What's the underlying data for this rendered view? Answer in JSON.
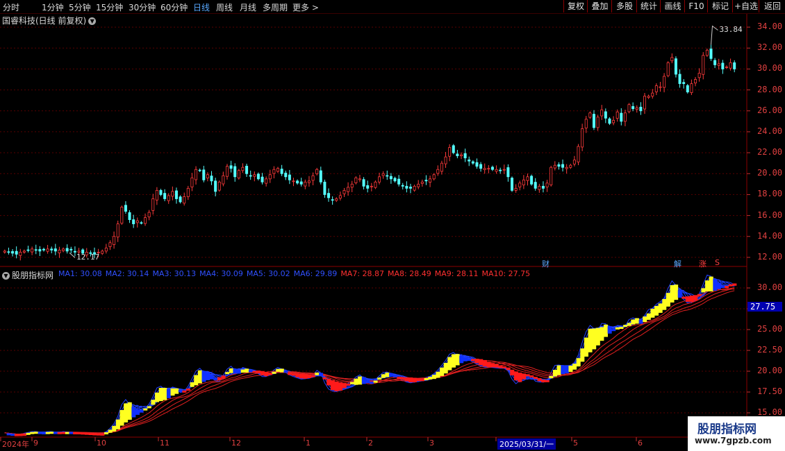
{
  "periods": [
    {
      "label": "分时",
      "active": false
    },
    {
      "label": "1分钟",
      "active": false
    },
    {
      "label": "5分钟",
      "active": false
    },
    {
      "label": "15分钟",
      "active": false
    },
    {
      "label": "30分钟",
      "active": false
    },
    {
      "label": "60分钟",
      "active": false
    },
    {
      "label": "日线",
      "active": true
    },
    {
      "label": "周线",
      "active": false
    },
    {
      "label": "月线",
      "active": false
    },
    {
      "label": "多周期",
      "active": false
    },
    {
      "label": "更多 >",
      "active": false
    }
  ],
  "toolbar": [
    "复权",
    "叠加",
    "多股",
    "统计",
    "画线",
    "F10",
    "标记",
    "+自选",
    "返回"
  ],
  "stock_title": "国睿科技(日线 前复权)",
  "price_axis": [
    "34.00",
    "32.00",
    "30.00",
    "28.00",
    "26.00",
    "24.00",
    "22.00",
    "20.00",
    "18.00",
    "16.00",
    "14.00",
    "12.00"
  ],
  "price_high_label": "33.84",
  "price_low_label": "12.17",
  "markers": {
    "cai": "财",
    "jie": "解",
    "zhang": "涨",
    "s": "S"
  },
  "indicator": {
    "name": "股朋指标网",
    "ma": [
      {
        "text": "MA1: 30.08",
        "color": "#3050ff"
      },
      {
        "text": "MA2: 30.14",
        "color": "#3050ff"
      },
      {
        "text": "MA3: 30.13",
        "color": "#3050ff"
      },
      {
        "text": "MA4: 30.09",
        "color": "#3050ff"
      },
      {
        "text": "MA5: 30.02",
        "color": "#3050ff"
      },
      {
        "text": "MA6: 29.89",
        "color": "#3050ff"
      },
      {
        "text": "MA7: 28.87",
        "color": "#ff3030"
      },
      {
        "text": "MA8: 28.49",
        "color": "#ff3030"
      },
      {
        "text": "MA9: 28.11",
        "color": "#ff3030"
      },
      {
        "text": "MA10: 27.75",
        "color": "#ff3030"
      }
    ],
    "axis": [
      "30.00",
      "27.50",
      "25.00",
      "22.50",
      "20.00",
      "17.50",
      "15.00"
    ],
    "current": "27.75"
  },
  "dates": [
    {
      "label": "2024年",
      "highlight": false
    },
    {
      "label": "9",
      "highlight": false
    },
    {
      "label": "10",
      "highlight": false
    },
    {
      "label": "11",
      "highlight": false
    },
    {
      "label": "12",
      "highlight": false
    },
    {
      "label": "1",
      "highlight": false
    },
    {
      "label": "2",
      "highlight": false
    },
    {
      "label": "3",
      "highlight": false
    },
    {
      "label": "2025/03/31/一",
      "highlight": true
    },
    {
      "label": "5",
      "highlight": false
    },
    {
      "label": "6",
      "highlight": false
    }
  ],
  "watermark": {
    "line1": "股朋指标网",
    "line2": "www.7gpzb.com"
  },
  "chart_data": {
    "type": "candlestick",
    "price_range": [
      11.2,
      35.2
    ],
    "indicator_range": [
      15,
      31.5
    ],
    "closes": [
      12.6,
      12.5,
      12.4,
      12.3,
      12.5,
      12.6,
      12.7,
      12.8,
      12.7,
      12.6,
      12.7,
      12.8,
      12.7,
      12.6,
      12.7,
      12.8,
      12.6,
      12.7,
      12.5,
      12.6,
      12.4,
      12.5,
      12.4,
      12.3,
      12.5,
      12.6,
      12.9,
      13.4,
      14.0,
      15.2,
      16.8,
      16.4,
      15.6,
      15.2,
      15.5,
      15.3,
      15.8,
      16.3,
      17.6,
      18.4,
      18.0,
      17.6,
      17.9,
      18.3,
      17.6,
      17.3,
      17.8,
      18.6,
      19.6,
      20.4,
      20.3,
      19.4,
      19.9,
      19.3,
      18.3,
      19.2,
      19.8,
      20.7,
      20.5,
      19.7,
      20.3,
      20.6,
      20.0,
      19.8,
      19.9,
      19.5,
      19.2,
      19.5,
      19.9,
      20.4,
      20.5,
      20.0,
      19.7,
      19.4,
      19.3,
      19.1,
      19.0,
      19.2,
      19.3,
      19.8,
      20.4,
      19.2,
      18.0,
      17.7,
      17.5,
      17.6,
      17.9,
      18.4,
      18.7,
      19.0,
      19.6,
      19.5,
      18.8,
      18.6,
      18.8,
      19.2,
      19.7,
      20.0,
      19.8,
      19.5,
      19.3,
      19.0,
      18.8,
      18.6,
      18.6,
      18.8,
      19.0,
      19.2,
      19.3,
      19.5,
      19.9,
      20.4,
      21.0,
      21.6,
      22.5,
      22.0,
      21.7,
      21.8,
      21.5,
      21.2,
      21.0,
      20.7,
      20.5,
      20.5,
      20.5,
      20.4,
      20.4,
      20.3,
      20.4,
      19.7,
      18.4,
      18.6,
      19.1,
      19.4,
      19.7,
      19.0,
      18.6,
      18.8,
      18.6,
      19.1,
      20.6,
      20.8,
      20.7,
      20.6,
      20.6,
      20.8,
      21.3,
      22.6,
      24.3,
      25.2,
      25.8,
      24.4,
      25.4,
      26.1,
      25.3,
      24.8,
      25.1,
      25.9,
      25.0,
      25.8,
      26.6,
      26.2,
      26.3,
      26.0,
      27.4,
      27.4,
      27.7,
      28.4,
      28.3,
      29.3,
      30.6,
      31.1,
      29.5,
      28.6,
      28.6,
      27.8,
      28.6,
      29.0,
      29.6,
      31.3,
      31.8,
      31.0,
      30.4,
      30.5,
      30.0,
      30.2,
      30.6,
      30.0
    ],
    "ma_labels": [
      "MA1",
      "MA2",
      "MA3",
      "MA4",
      "MA5",
      "MA6",
      "MA7",
      "MA8",
      "MA9",
      "MA10"
    ]
  }
}
